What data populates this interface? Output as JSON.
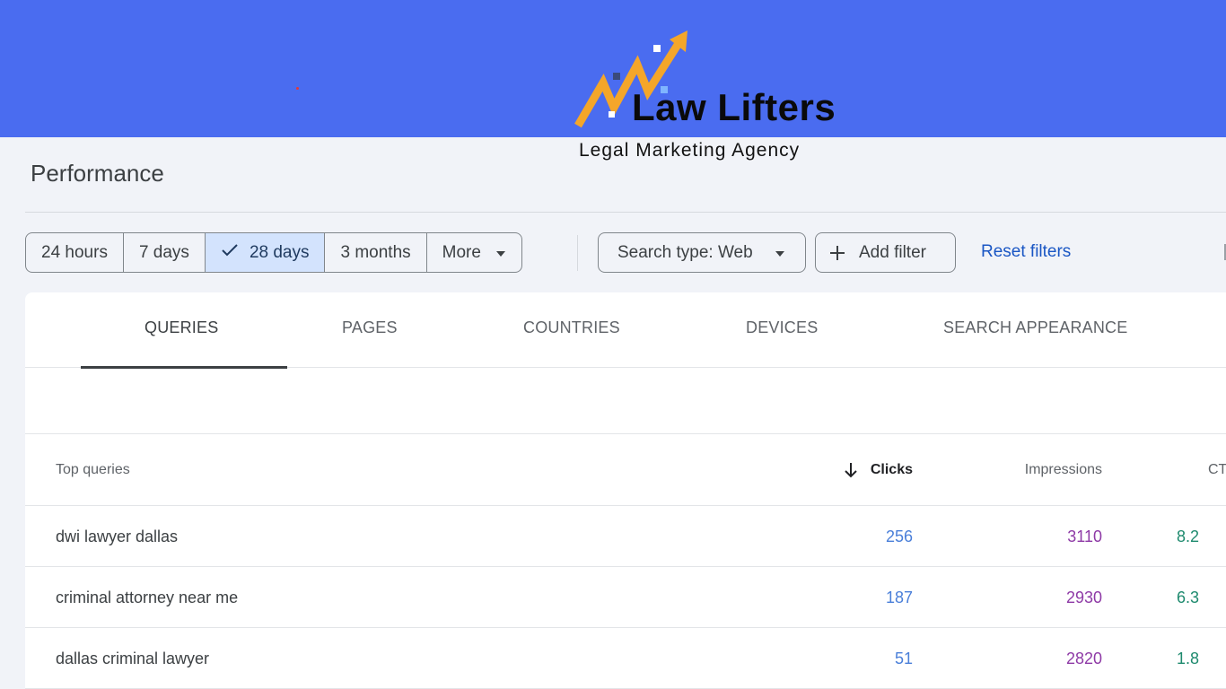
{
  "brand": {
    "name": "Law Lifters",
    "tagline": "Legal Marketing Agency",
    "colors": {
      "banner": "#4a6cf0",
      "arrow": "#f4a62a",
      "text": "#0a0a0a"
    }
  },
  "page": {
    "title": "Performance"
  },
  "date_range": {
    "options": [
      "24 hours",
      "7 days",
      "28 days",
      "3 months",
      "More"
    ],
    "selected": "28 days"
  },
  "filters": {
    "search_type": "Search type: Web",
    "add_filter": "Add filter",
    "reset": "Reset filters"
  },
  "tabs": [
    "QUERIES",
    "PAGES",
    "COUNTRIES",
    "DEVICES",
    "SEARCH APPEARANCE"
  ],
  "active_tab": "QUERIES",
  "table": {
    "headers": {
      "query": "Top queries",
      "clicks": "Clicks",
      "impressions": "Impressions",
      "ctr": "CT"
    },
    "sort": {
      "column": "Clicks",
      "direction": "descending"
    },
    "rows": [
      {
        "query": "dwi lawyer dallas",
        "clicks": "256",
        "impressions": "3110",
        "ctr": "8.2"
      },
      {
        "query": "criminal attorney near me",
        "clicks": "187",
        "impressions": "2930",
        "ctr": "6.3"
      },
      {
        "query": "dallas criminal lawyer",
        "clicks": "51",
        "impressions": "2820",
        "ctr": "1.8"
      }
    ]
  },
  "icons": {
    "check": "check-icon",
    "dropdown": "caret-down-icon",
    "add": "plus-icon",
    "sort": "arrow-down-icon"
  }
}
